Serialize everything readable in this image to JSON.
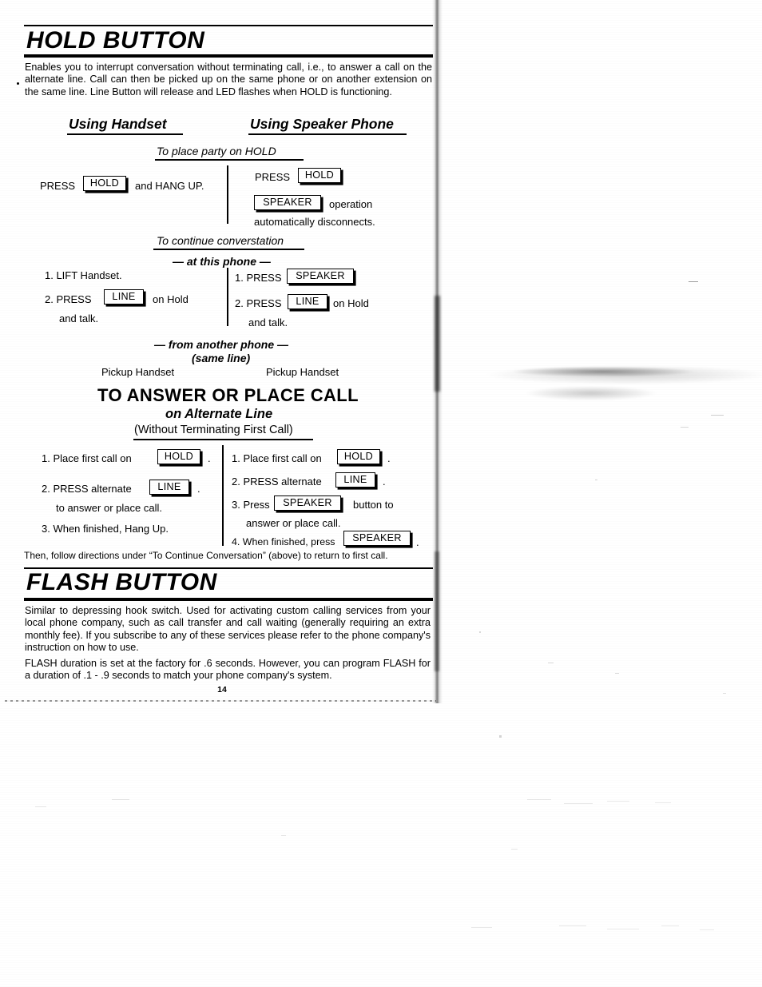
{
  "document": {
    "page_number": "14"
  },
  "hold_section": {
    "title": "HOLD BUTTON",
    "intro": "Enables you to interrupt conversation without terminating call, i.e., to answer a call on the alternate line. Call can then be picked up on the same phone or on another extension on the same line. Line Button will release and LED flashes when HOLD is functioning.",
    "column_headings": {
      "handset": "Using Handset",
      "speaker": "Using Speaker Phone"
    },
    "place_on_hold": {
      "heading": "To place party on HOLD",
      "handset": {
        "press_label": "PRESS",
        "key": "HOLD",
        "after": "and HANG UP."
      },
      "speaker": {
        "press_label": "PRESS",
        "key": "HOLD",
        "key2": "SPEAKER",
        "line2_after": "operation",
        "line3": "automatically disconnects."
      }
    },
    "continue_conversation": {
      "heading": "To continue converstation",
      "subheading_at_this_phone": "— at this phone —",
      "handset_steps": {
        "step1": "1.  LIFT Handset.",
        "step2_pre": "2.  PRESS",
        "step2_key": "LINE",
        "step2_post": "on Hold",
        "step2_cont": "and talk."
      },
      "speaker_steps": {
        "step1_pre": "1.  PRESS",
        "step1_key": "SPEAKER",
        "step2_pre": "2.  PRESS",
        "step2_key": "LINE",
        "step2_post": "on Hold",
        "step2_cont": "and talk."
      },
      "subheading_another_phone": "— from another phone —",
      "subheading_same_line": "(same line)",
      "pickup_handset_left": "Pickup Handset",
      "pickup_handset_right": "Pickup Handset"
    },
    "answer_or_place": {
      "title": "TO ANSWER OR PLACE CALL",
      "subtitle": "on Alternate Line",
      "note": "(Without Terminating First Call)",
      "handset_steps": {
        "s1_pre": "1.  Place first call on",
        "s1_key": "HOLD",
        "s1_post": ".",
        "s2_pre": "2.  PRESS alternate",
        "s2_key": "LINE",
        "s2_post": ".",
        "s2_cont": "to answer or place call.",
        "s3": "3.  When finished, Hang Up."
      },
      "speaker_steps": {
        "s1_pre": "1.  Place first call on",
        "s1_key": "HOLD",
        "s1_post": ".",
        "s2_pre": "2.  PRESS alternate",
        "s2_key": "LINE",
        "s2_post": ".",
        "s3_pre": "3.  Press",
        "s3_key": "SPEAKER",
        "s3_post": "button to",
        "s3_cont": "answer or place call.",
        "s4_pre": "4.  When finished, press",
        "s4_key": "SPEAKER",
        "s4_post": "."
      }
    },
    "closing_note": "Then, follow directions under “To Continue Conversation” (above) to return to first call."
  },
  "flash_section": {
    "title": "FLASH BUTTON",
    "paragraph1": "Similar to depressing hook switch. Used for activating custom calling services from your local phone company, such as call transfer and call waiting (generally requiring an extra monthly fee). If you subscribe to any of these services please refer to the phone company's instruction on how to use.",
    "paragraph2": "FLASH duration is set at the factory for .6 seconds. However, you can program FLASH for a duration of .1 - .9 seconds to match your phone company's system."
  }
}
